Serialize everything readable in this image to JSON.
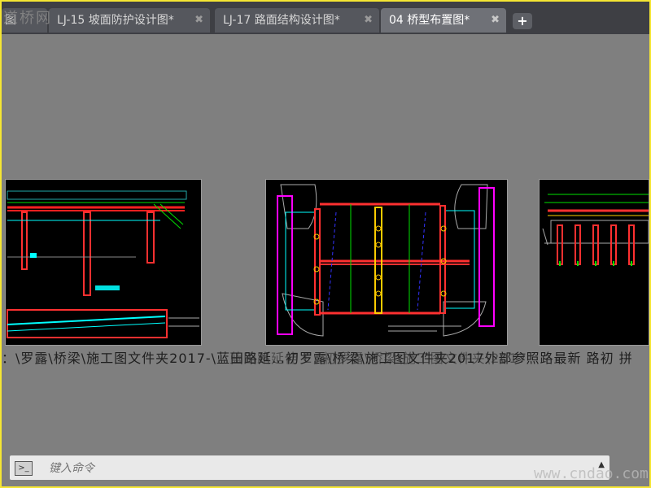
{
  "tabs": [
    {
      "label": "图",
      "partial": true
    },
    {
      "label": "LJ-15 坡面防护设计图*"
    },
    {
      "label": "LJ-17 路面结构设计图*"
    },
    {
      "label": "04 桥型布置图*",
      "active": true
    }
  ],
  "tab_close_glyph": "✖",
  "add_tab_glyph": "+",
  "watermark_top": "道桥网",
  "caption_line": "：\\罗露\\桥梁\\施工图文件夹2017-\\蓝田路延…初罗露\\桥梁\\施工图文件夹2017外部参照路最新 路初 拼",
  "caption_overlap": "蓝田路延伸 E:\\初罗露\\桥梁\\施工图文件夹\\2017",
  "command": {
    "placeholder": "键入命令",
    "icon": "terminal-icon"
  },
  "watermark_bottom": "www.cndao.com",
  "colors": {
    "frame_border": "#f5e632",
    "canvas": "#7f7f7f",
    "tabbar": "#3e3f44"
  }
}
